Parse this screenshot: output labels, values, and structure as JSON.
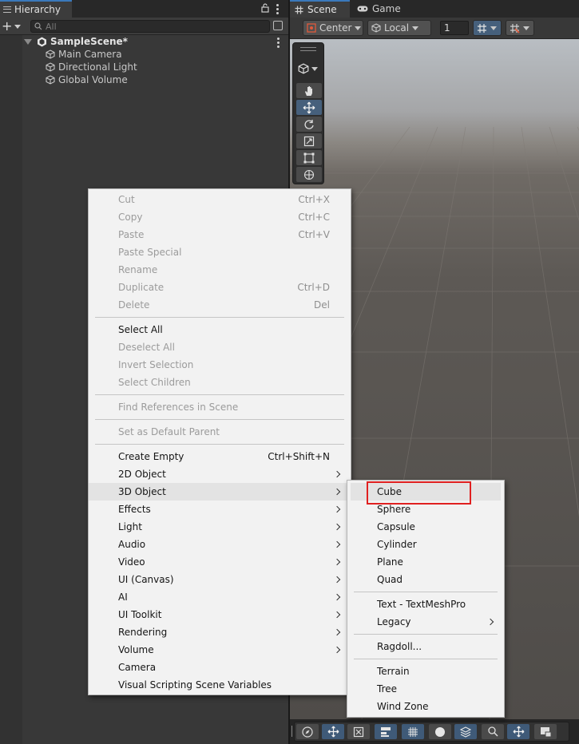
{
  "hierarchy": {
    "tab_label": "Hierarchy",
    "search_placeholder": "All",
    "scene_name": "SampleScene*",
    "objects": [
      "Main Camera",
      "Directional Light",
      "Global Volume"
    ]
  },
  "scene": {
    "tabs": [
      "Scene",
      "Game"
    ],
    "pivot_mode": "Center",
    "pivot_rotation": "Local",
    "grid_value": "1"
  },
  "context_menu": {
    "items": [
      {
        "label": "Cut",
        "shortcut": "Ctrl+X",
        "enabled": false
      },
      {
        "label": "Copy",
        "shortcut": "Ctrl+C",
        "enabled": false
      },
      {
        "label": "Paste",
        "shortcut": "Ctrl+V",
        "enabled": false
      },
      {
        "label": "Paste Special",
        "shortcut": "",
        "enabled": false
      },
      {
        "label": "Rename",
        "shortcut": "",
        "enabled": false
      },
      {
        "label": "Duplicate",
        "shortcut": "Ctrl+D",
        "enabled": false
      },
      {
        "label": "Delete",
        "shortcut": "Del",
        "enabled": false
      },
      {
        "label": "Select All",
        "shortcut": "",
        "enabled": true
      },
      {
        "label": "Deselect All",
        "shortcut": "",
        "enabled": false
      },
      {
        "label": "Invert Selection",
        "shortcut": "",
        "enabled": false
      },
      {
        "label": "Select Children",
        "shortcut": "",
        "enabled": false
      },
      {
        "label": "Find References in Scene",
        "shortcut": "",
        "enabled": false
      },
      {
        "label": "Set as Default Parent",
        "shortcut": "",
        "enabled": false
      },
      {
        "label": "Create Empty",
        "shortcut": "Ctrl+Shift+N",
        "enabled": true
      },
      {
        "label": "2D Object",
        "submenu": true
      },
      {
        "label": "3D Object",
        "submenu": true,
        "highlighted": true
      },
      {
        "label": "Effects",
        "submenu": true
      },
      {
        "label": "Light",
        "submenu": true
      },
      {
        "label": "Audio",
        "submenu": true
      },
      {
        "label": "Video",
        "submenu": true
      },
      {
        "label": "UI (Canvas)",
        "submenu": true
      },
      {
        "label": "AI",
        "submenu": true
      },
      {
        "label": "UI Toolkit",
        "submenu": true
      },
      {
        "label": "Rendering",
        "submenu": true
      },
      {
        "label": "Volume",
        "submenu": true
      },
      {
        "label": "Camera",
        "submenu": false
      },
      {
        "label": "Visual Scripting Scene Variables",
        "submenu": false
      }
    ]
  },
  "submenu_3d": {
    "items": [
      "Cube",
      "Sphere",
      "Capsule",
      "Cylinder",
      "Plane",
      "Quad",
      "Text - TextMeshPro",
      "Legacy",
      "Ragdoll...",
      "Terrain",
      "Tree",
      "Wind Zone"
    ],
    "highlighted": "Cube",
    "highlight_color": "#e02020"
  }
}
